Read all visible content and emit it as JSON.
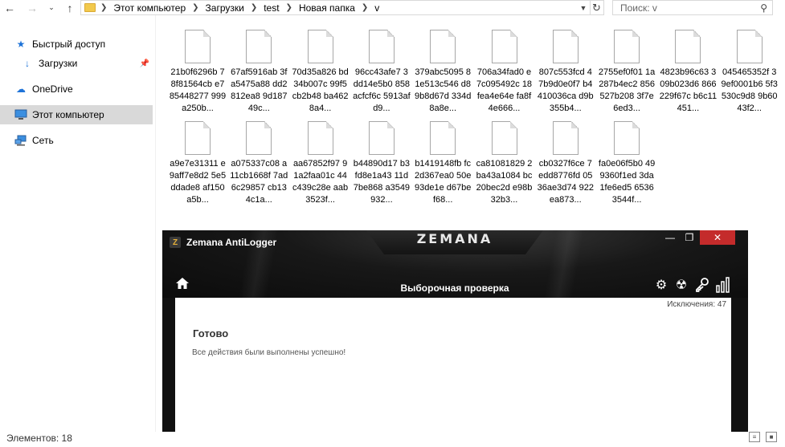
{
  "address": {
    "crumbs": [
      "Этот компьютер",
      "Загрузки",
      "test",
      "Новая папка",
      "v"
    ],
    "search_placeholder": "Поиск: v"
  },
  "nav": {
    "items": [
      {
        "label": "Быстрый доступ",
        "icon": "star-icon"
      },
      {
        "label": "Загрузки",
        "icon": "download-arrow-icon"
      },
      {
        "label": "OneDrive",
        "icon": "cloud-icon"
      },
      {
        "label": "Этот компьютер",
        "icon": "computer-icon"
      },
      {
        "label": "Сеть",
        "icon": "network-icon"
      }
    ]
  },
  "files": [
    "21b0f6296b 78f81564cb e785448277 999a250b...",
    "67af5916ab 3fa5475a88 dd2812ea8 9d18749c...",
    "70d35a826 bd34b007c 99f5cb2b48 ba4628a4...",
    "96cc43afe7 3dd14e5b0 858acfcf6c 5913afd9...",
    "379abc5095 81e513c546 d89b8d67d 334d8a8e...",
    "706a34fad0 e7c095492c 18fea4e64e fa8f4e666...",
    "807c553fcd 47b9d0e0f7 b4410036ca d9b355b4...",
    "2755ef0f01 1a287b4ec2 856527b208 3f7e6ed3...",
    "4823b96c63 309b023d6 866229f67c b6c11451...",
    "045465352f 39ef0001b6 5f3530c9d8 9b6043f2...",
    "a9e7e31311 e9aff7e8d2 5e5ddade8 af150a5b...",
    "a075337c08 a11cb1668f 7ad6c29857 cb134c1a...",
    "aa67852f97 91a2faa01c 44c439c28e aab3523f...",
    "b44890d17 b3fd8e1a43 11d7be868 a3549932...",
    "b1419148fb fc2d367ea0 50e93de1e d67bef68...",
    "ca81081829 2ba43a1084 bc20bec2d e98b32b3...",
    "cb0327f6ce 7edd8776fd 0536ae3d74 922ea873...",
    "fa0e06f5b0 499360f1ed 3da1fe6ed5 65363544f..."
  ],
  "zemana": {
    "app_title": "Zemana AntiLogger",
    "brand": "ZEMANA",
    "section_title": "Выборочная проверка",
    "exclusions": "Исключения: 47",
    "status_title": "Готово",
    "status_message": "Все действия были выполнены успешно!",
    "close_color": "#c42b2b"
  },
  "status": {
    "items_count": "Элементов: 18"
  }
}
